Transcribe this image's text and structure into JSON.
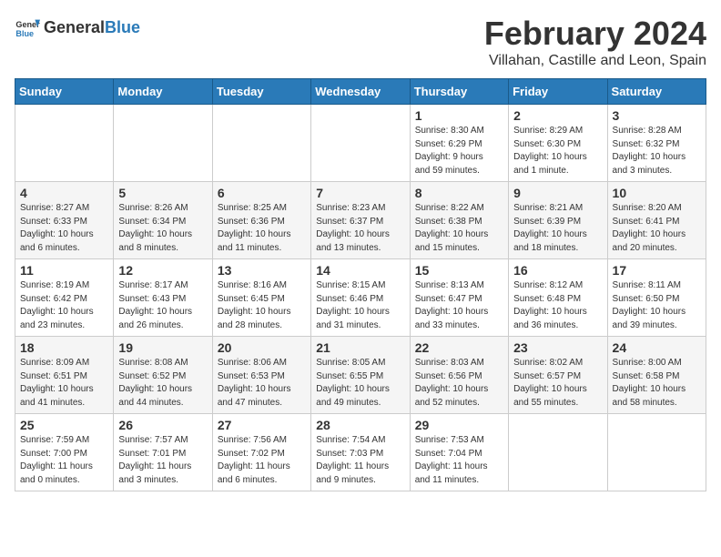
{
  "logo": {
    "general": "General",
    "blue": "Blue"
  },
  "title": "February 2024",
  "location": "Villahan, Castille and Leon, Spain",
  "days_header": [
    "Sunday",
    "Monday",
    "Tuesday",
    "Wednesday",
    "Thursday",
    "Friday",
    "Saturday"
  ],
  "weeks": [
    [
      {
        "day": "",
        "info": ""
      },
      {
        "day": "",
        "info": ""
      },
      {
        "day": "",
        "info": ""
      },
      {
        "day": "",
        "info": ""
      },
      {
        "day": "1",
        "info": "Sunrise: 8:30 AM\nSunset: 6:29 PM\nDaylight: 9 hours\nand 59 minutes."
      },
      {
        "day": "2",
        "info": "Sunrise: 8:29 AM\nSunset: 6:30 PM\nDaylight: 10 hours\nand 1 minute."
      },
      {
        "day": "3",
        "info": "Sunrise: 8:28 AM\nSunset: 6:32 PM\nDaylight: 10 hours\nand 3 minutes."
      }
    ],
    [
      {
        "day": "4",
        "info": "Sunrise: 8:27 AM\nSunset: 6:33 PM\nDaylight: 10 hours\nand 6 minutes."
      },
      {
        "day": "5",
        "info": "Sunrise: 8:26 AM\nSunset: 6:34 PM\nDaylight: 10 hours\nand 8 minutes."
      },
      {
        "day": "6",
        "info": "Sunrise: 8:25 AM\nSunset: 6:36 PM\nDaylight: 10 hours\nand 11 minutes."
      },
      {
        "day": "7",
        "info": "Sunrise: 8:23 AM\nSunset: 6:37 PM\nDaylight: 10 hours\nand 13 minutes."
      },
      {
        "day": "8",
        "info": "Sunrise: 8:22 AM\nSunset: 6:38 PM\nDaylight: 10 hours\nand 15 minutes."
      },
      {
        "day": "9",
        "info": "Sunrise: 8:21 AM\nSunset: 6:39 PM\nDaylight: 10 hours\nand 18 minutes."
      },
      {
        "day": "10",
        "info": "Sunrise: 8:20 AM\nSunset: 6:41 PM\nDaylight: 10 hours\nand 20 minutes."
      }
    ],
    [
      {
        "day": "11",
        "info": "Sunrise: 8:19 AM\nSunset: 6:42 PM\nDaylight: 10 hours\nand 23 minutes."
      },
      {
        "day": "12",
        "info": "Sunrise: 8:17 AM\nSunset: 6:43 PM\nDaylight: 10 hours\nand 26 minutes."
      },
      {
        "day": "13",
        "info": "Sunrise: 8:16 AM\nSunset: 6:45 PM\nDaylight: 10 hours\nand 28 minutes."
      },
      {
        "day": "14",
        "info": "Sunrise: 8:15 AM\nSunset: 6:46 PM\nDaylight: 10 hours\nand 31 minutes."
      },
      {
        "day": "15",
        "info": "Sunrise: 8:13 AM\nSunset: 6:47 PM\nDaylight: 10 hours\nand 33 minutes."
      },
      {
        "day": "16",
        "info": "Sunrise: 8:12 AM\nSunset: 6:48 PM\nDaylight: 10 hours\nand 36 minutes."
      },
      {
        "day": "17",
        "info": "Sunrise: 8:11 AM\nSunset: 6:50 PM\nDaylight: 10 hours\nand 39 minutes."
      }
    ],
    [
      {
        "day": "18",
        "info": "Sunrise: 8:09 AM\nSunset: 6:51 PM\nDaylight: 10 hours\nand 41 minutes."
      },
      {
        "day": "19",
        "info": "Sunrise: 8:08 AM\nSunset: 6:52 PM\nDaylight: 10 hours\nand 44 minutes."
      },
      {
        "day": "20",
        "info": "Sunrise: 8:06 AM\nSunset: 6:53 PM\nDaylight: 10 hours\nand 47 minutes."
      },
      {
        "day": "21",
        "info": "Sunrise: 8:05 AM\nSunset: 6:55 PM\nDaylight: 10 hours\nand 49 minutes."
      },
      {
        "day": "22",
        "info": "Sunrise: 8:03 AM\nSunset: 6:56 PM\nDaylight: 10 hours\nand 52 minutes."
      },
      {
        "day": "23",
        "info": "Sunrise: 8:02 AM\nSunset: 6:57 PM\nDaylight: 10 hours\nand 55 minutes."
      },
      {
        "day": "24",
        "info": "Sunrise: 8:00 AM\nSunset: 6:58 PM\nDaylight: 10 hours\nand 58 minutes."
      }
    ],
    [
      {
        "day": "25",
        "info": "Sunrise: 7:59 AM\nSunset: 7:00 PM\nDaylight: 11 hours\nand 0 minutes."
      },
      {
        "day": "26",
        "info": "Sunrise: 7:57 AM\nSunset: 7:01 PM\nDaylight: 11 hours\nand 3 minutes."
      },
      {
        "day": "27",
        "info": "Sunrise: 7:56 AM\nSunset: 7:02 PM\nDaylight: 11 hours\nand 6 minutes."
      },
      {
        "day": "28",
        "info": "Sunrise: 7:54 AM\nSunset: 7:03 PM\nDaylight: 11 hours\nand 9 minutes."
      },
      {
        "day": "29",
        "info": "Sunrise: 7:53 AM\nSunset: 7:04 PM\nDaylight: 11 hours\nand 11 minutes."
      },
      {
        "day": "",
        "info": ""
      },
      {
        "day": "",
        "info": ""
      }
    ]
  ]
}
